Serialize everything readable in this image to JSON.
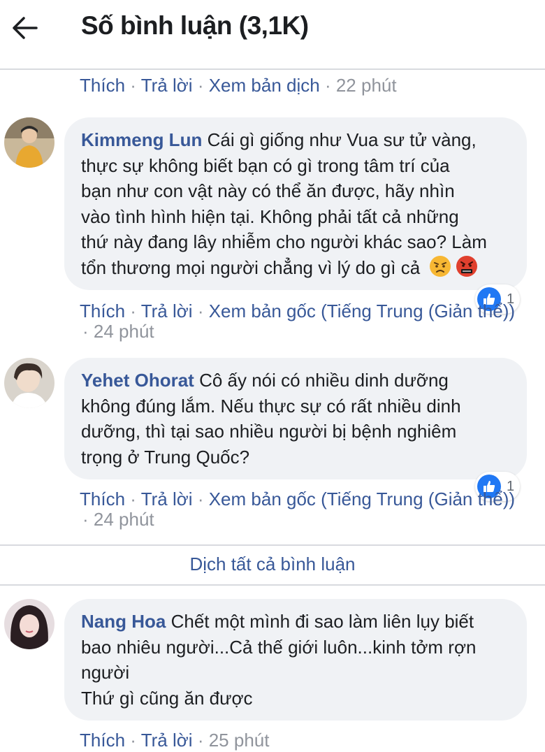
{
  "header": {
    "back_icon": "arrow-left-icon",
    "title": "Số bình luận (3,1K)"
  },
  "top_actions": {
    "like": "Thích",
    "reply": "Trả lời",
    "translate": "Xem bản dịch",
    "time": "22 phút",
    "sep": "·"
  },
  "comments": [
    {
      "author": "Kimmeng Lun",
      "lines": [
        "Cái gì giống như Vua sư tử vàng,",
        "thực sự không biết bạn có gì trong tâm trí của",
        "bạn như con vật này có thể ăn được, hãy nhìn",
        "vào tình hình hiện tại. Không phải tất cả những",
        "thứ này đang lây nhiễm cho người khác sao? Làm",
        "tổn thương mọi người chẳng vì lý do gì cả"
      ],
      "emojis": [
        "angry-face-icon",
        "cursing-face-icon"
      ],
      "reaction_count": "1",
      "actions": {
        "like": "Thích",
        "reply": "Trả lời",
        "original": "Xem bản gốc (Tiếng Trung (Giản thể))",
        "time": "24 phút"
      }
    },
    {
      "author": "Yehet Ohorat",
      "lines": [
        "Cô ấy nói có nhiều dinh dưỡng",
        "không đúng lắm. Nếu thực sự có rất nhiều dinh",
        "dưỡng, thì tại sao nhiều người bị bệnh nghiêm",
        "trọng ở Trung Quốc?"
      ],
      "reaction_count": "1",
      "actions": {
        "like": "Thích",
        "reply": "Trả lời",
        "original": "Xem bản gốc (Tiếng Trung (Giản thể))",
        "time": "24 phút"
      }
    },
    {
      "author": "Nang Hoa",
      "lines": [
        "Chết một mình đi sao làm liên lụy biết",
        "bao nhiêu người...Cả thế giới luôn...kinh tởm rợn",
        "người",
        "Thứ gì cũng ăn được"
      ],
      "actions": {
        "like": "Thích",
        "reply": "Trả lời",
        "time": "25 phút"
      }
    }
  ],
  "translate_all": "Dịch tất cả bình luận",
  "colors": {
    "link": "#385898",
    "meta": "#90949c",
    "bubble": "#f0f2f5",
    "like_blue": "#2078f4"
  }
}
